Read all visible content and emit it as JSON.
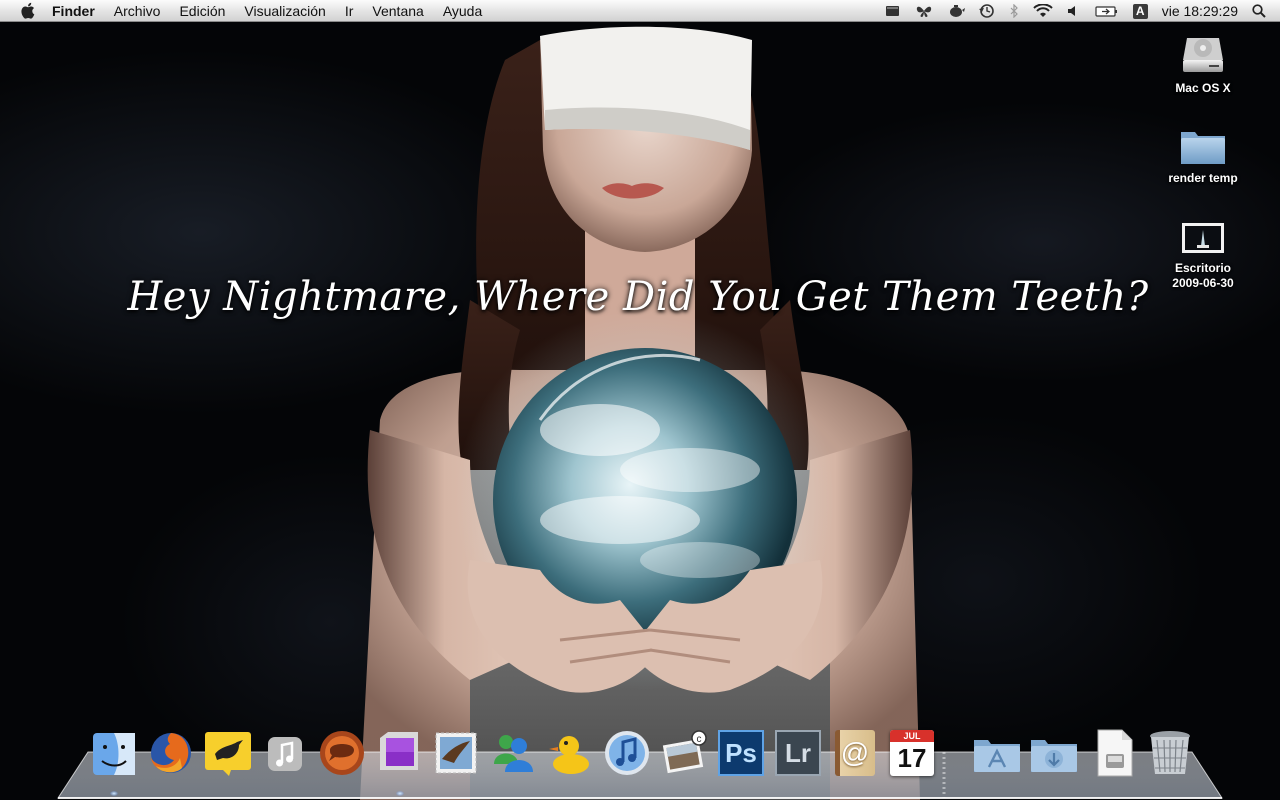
{
  "menubar": {
    "app_name": "Finder",
    "menus": [
      "Archivo",
      "Edición",
      "Visualización",
      "Ir",
      "Ventana",
      "Ayuda"
    ],
    "clock": "vie 18:29:29",
    "input_source": "A"
  },
  "wallpaper": {
    "quote": "Hey Nightmare, Where Did You Get Them Teeth?"
  },
  "desktop_icons": [
    {
      "label_lines": [
        "Mac OS X"
      ],
      "icon": "hard-drive-icon"
    },
    {
      "label_lines": [
        "render temp"
      ],
      "icon": "folder-icon"
    },
    {
      "label_lines": [
        "Escritorio",
        "2009-06-30"
      ],
      "icon": "screenshot-file-icon"
    }
  ],
  "dock": {
    "items": [
      {
        "name": "finder",
        "icon": "finder-icon"
      },
      {
        "name": "firefox",
        "icon": "firefox-icon"
      },
      {
        "name": "twitter-client",
        "icon": "bird-icon"
      },
      {
        "name": "music-player",
        "icon": "music-note-icon"
      },
      {
        "name": "chat-app",
        "icon": "chat-bubble-icon"
      },
      {
        "name": "purple-app",
        "icon": "purple-square-icon"
      },
      {
        "name": "mail-stamp",
        "icon": "eagle-stamp-icon"
      },
      {
        "name": "messenger",
        "icon": "messenger-people-icon"
      },
      {
        "name": "cyberduck",
        "icon": "duck-icon"
      },
      {
        "name": "itunes",
        "icon": "itunes-icon"
      },
      {
        "name": "preview",
        "icon": "photo-preview-icon"
      },
      {
        "name": "photoshop",
        "icon": "photoshop-icon",
        "text": "Ps"
      },
      {
        "name": "lightroom",
        "icon": "lightroom-icon",
        "text": "Lr"
      },
      {
        "name": "address-book",
        "icon": "address-book-icon",
        "text": "@"
      },
      {
        "name": "ical",
        "icon": "calendar-icon",
        "month": "JUL",
        "day": "17"
      },
      {
        "name": "applications",
        "icon": "applications-folder-icon"
      },
      {
        "name": "downloads",
        "icon": "downloads-folder-icon"
      },
      {
        "name": "document",
        "icon": "document-icon"
      },
      {
        "name": "trash",
        "icon": "trash-icon"
      }
    ],
    "accent": "#2b7de0"
  }
}
